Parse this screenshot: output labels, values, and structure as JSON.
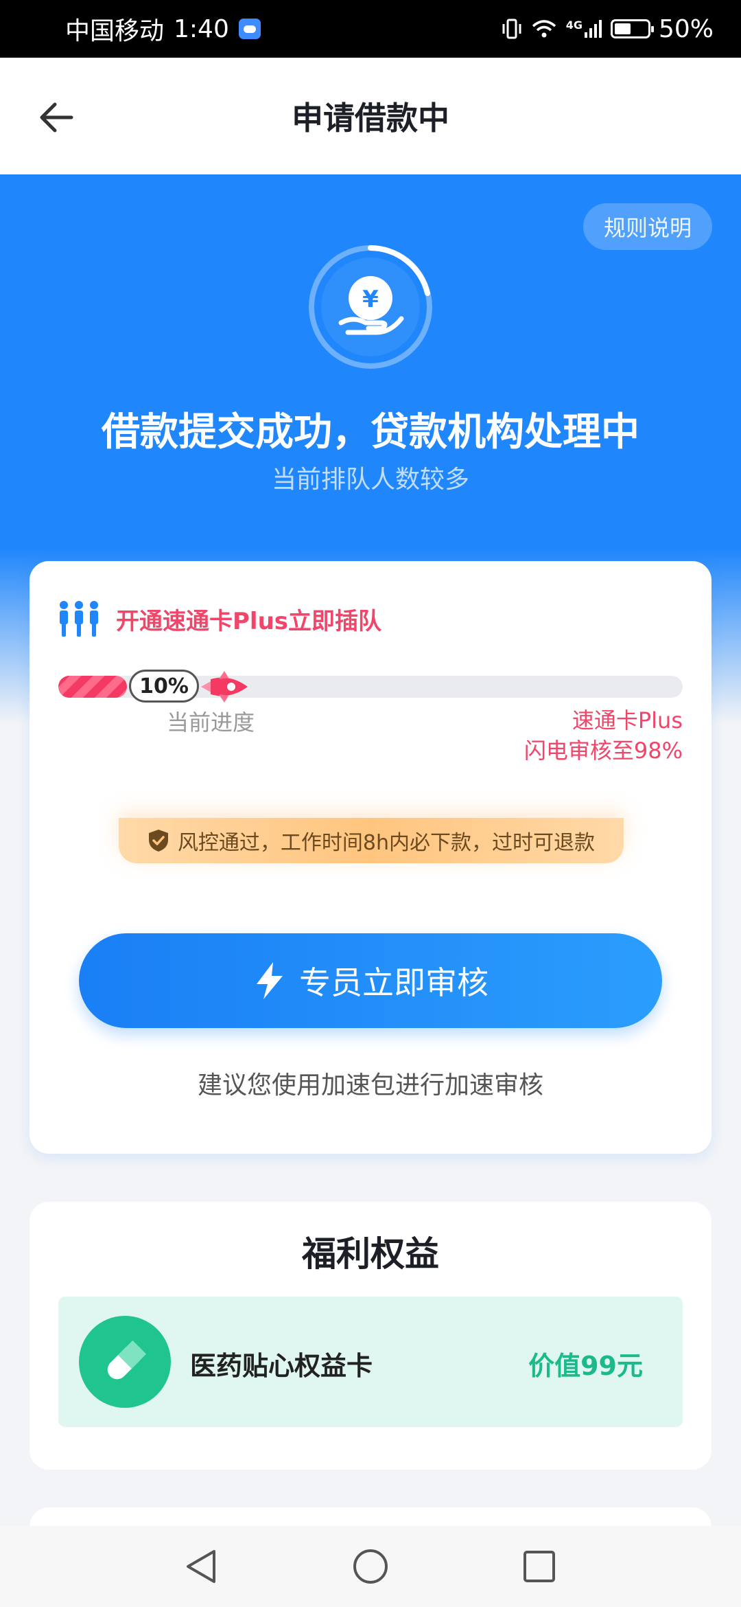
{
  "status_bar": {
    "carrier": "中国移动",
    "time": "1:40",
    "network": "4G",
    "battery": "50%",
    "battery_level": 0.5
  },
  "nav": {
    "title": "申请借款中"
  },
  "hero": {
    "rules_label": "规则说明",
    "icon": "yuan-hand-icon",
    "title": "借款提交成功，贷款机构处理中",
    "subtitle": "当前排队人数较多"
  },
  "progress_card": {
    "promo_text": "开通速通卡Plus立即插队",
    "progress_value": 10,
    "progress_text": "10%",
    "progress_label": "当前进度",
    "target_line1": "速通卡Plus",
    "target_line2": "闪电审核至98%",
    "guarantee": "风控通过，工作时间8h内必下款，过时可退款",
    "button_label": "专员立即审核",
    "hint": "建议您使用加速包进行加速审核"
  },
  "benefits": {
    "title": "福利权益",
    "items": [
      {
        "icon": "capsule-icon",
        "name": "医药贴心权益卡",
        "value": "价值99元"
      }
    ]
  },
  "colors": {
    "brand_blue": "#1f86fb",
    "accent_red": "#f0466a",
    "benefit_green": "#1cb98b"
  }
}
